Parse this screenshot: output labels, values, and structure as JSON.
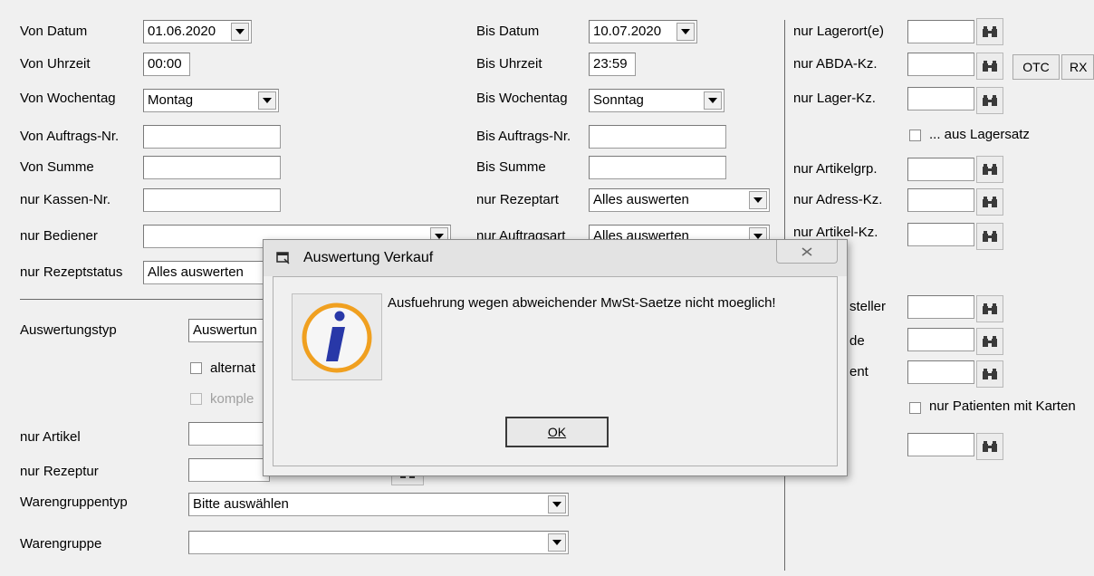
{
  "left": {
    "von_datum": {
      "label": "Von Datum",
      "value": "01.06.2020"
    },
    "von_uhrzeit": {
      "label": "Von Uhrzeit",
      "value": "00:00"
    },
    "von_wochentag": {
      "label": "Von Wochentag",
      "value": "Montag"
    },
    "von_auftrags_nr": {
      "label": "Von Auftrags-Nr.",
      "value": ""
    },
    "von_summe": {
      "label": "Von Summe",
      "value": ""
    },
    "nur_kassen_nr": {
      "label": "nur Kassen-Nr.",
      "value": ""
    },
    "nur_bediener": {
      "label": "nur Bediener",
      "value": ""
    },
    "nur_rezeptstatus": {
      "label": "nur Rezeptstatus",
      "value": "Alles auswerten"
    }
  },
  "middle": {
    "bis_datum": {
      "label": "Bis Datum",
      "value": "10.07.2020"
    },
    "bis_uhrzeit": {
      "label": "Bis Uhrzeit",
      "value": "23:59"
    },
    "bis_wochentag": {
      "label": "Bis Wochentag",
      "value": "Sonntag"
    },
    "bis_auftrags_nr": {
      "label": "Bis Auftrags-Nr.",
      "value": ""
    },
    "bis_summe": {
      "label": "Bis Summe",
      "value": ""
    },
    "nur_rezeptart": {
      "label": "nur Rezeptart",
      "value": "Alles auswerten"
    },
    "nur_auftragsart": {
      "label": "nur Auftragsart",
      "value": "Alles auswerten"
    }
  },
  "right": {
    "nur_lagerorte": {
      "label": "nur Lagerort(e)",
      "value": ""
    },
    "nur_abda_kz": {
      "label": "nur ABDA-Kz.",
      "value": ""
    },
    "otc_label": "OTC",
    "rx_label": "RX",
    "nur_lager_kz": {
      "label": "nur Lager-Kz.",
      "value": ""
    },
    "aus_lagersatz": "... aus Lagersatz",
    "nur_artikelgrp": {
      "label": "nur Artikelgrp.",
      "value": ""
    },
    "nur_adress_kz": {
      "label": "nur Adress-Kz.",
      "value": ""
    },
    "nur_artikel_kz": {
      "label": "nur Artikel-Kz.",
      "value": ""
    },
    "hersteller_partial": "steller",
    "kunde_partial": "de",
    "patient_partial": "ent",
    "nur_patienten_karten": "nur Patienten mit Karten"
  },
  "lower": {
    "auswertungstyp": {
      "label": "Auswertungstyp",
      "value": "Auswertun"
    },
    "alternativ_partial": "alternat",
    "komplett_partial": "komple",
    "nur_artikel": {
      "label": "nur Artikel",
      "value": ""
    },
    "nur_rezeptur": {
      "label": "nur Rezeptur",
      "value": ""
    },
    "warengruppentyp": {
      "label": "Warengruppentyp",
      "value": "Bitte auswählen"
    },
    "warengruppe": {
      "label": "Warengruppe",
      "value": ""
    }
  },
  "dialog": {
    "title": "Auswertung Verkauf",
    "message": "Ausfuehrung wegen abweichender MwSt-Saetze nicht moeglich!",
    "ok_label": "OK",
    "icon": "info-icon",
    "close_icon": "close-icon"
  },
  "colors": {
    "info_orange": "#f0a020",
    "info_blue": "#2838a8"
  }
}
